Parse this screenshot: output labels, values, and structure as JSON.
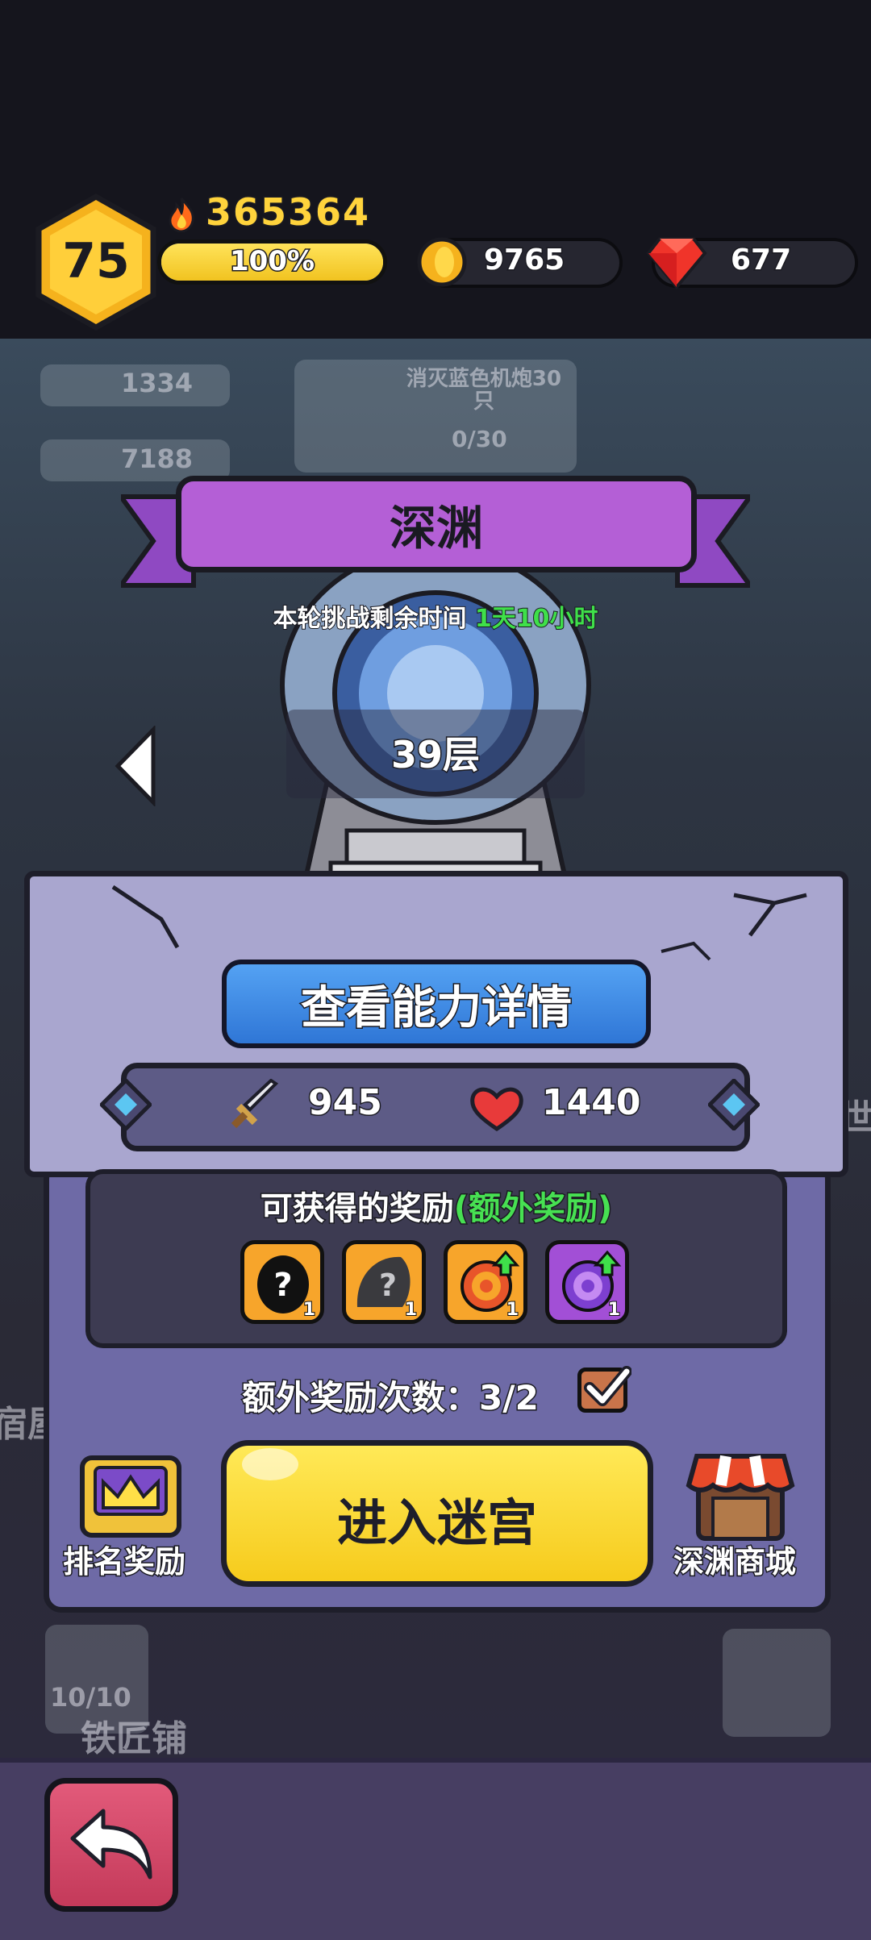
{
  "player": {
    "level": "75",
    "power": "365364",
    "xp_percent_label": "100%",
    "xp_fraction": 1.0
  },
  "currency": {
    "gold": "9765",
    "gems": "677"
  },
  "background": {
    "meat_count": "1334",
    "wood_count": "7188",
    "quest_text": "消灭蓝色机炮30只",
    "quest_progress": "0/30",
    "slime_count": "10/10",
    "shop_partial": "铁匠铺",
    "house_partial": "宿屋",
    "right_partial": "世"
  },
  "abyss": {
    "title": "深渊",
    "challenge_label": "本轮挑战剩余时间",
    "challenge_time": "1天10小时",
    "floor": "39层",
    "detail_button": "查看能力详情",
    "attack": "945",
    "hp": "1440",
    "rewards_title": "可获得的奖励",
    "rewards_extra": "(额外奖励)",
    "rewards": [
      {
        "icon": "mystery-black-egg-icon",
        "count": "1",
        "color": "#f7a52b"
      },
      {
        "icon": "mystery-gray-egg-icon",
        "count": "1",
        "color": "#f7a52b"
      },
      {
        "icon": "orange-orb-upgrade-icon",
        "count": "1",
        "color": "#f7a52b"
      },
      {
        "icon": "purple-orb-upgrade-icon",
        "count": "1",
        "color": "#a24fd6"
      }
    ],
    "extra_count_label": "额外奖励次数：3/2",
    "enter_button": "进入迷宫",
    "rank_button": "排名奖励",
    "shop_button": "深渊商城"
  },
  "colors": {
    "accent_purple": "#b45fd6",
    "accent_green": "#3fe04a",
    "accent_yellow": "#ffd33c",
    "back_button": "#d44a6a"
  }
}
